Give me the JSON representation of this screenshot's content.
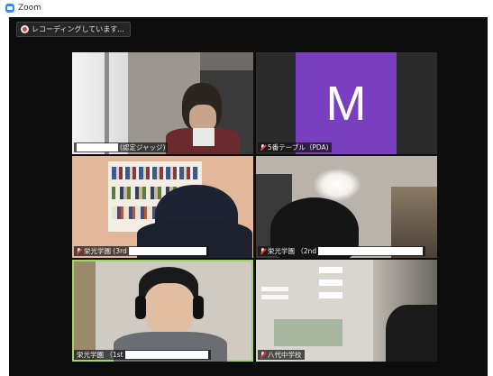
{
  "window": {
    "title": "Zoom",
    "icon": "zoom-logo-icon"
  },
  "recording": {
    "text": "レコーディングしています...",
    "icon": "cloud-record-icon"
  },
  "participants": [
    {
      "label": "(認定ジャッジ)",
      "muted": true,
      "kind": "video"
    },
    {
      "label": "5番テーブル（PDA)",
      "muted": true,
      "kind": "avatar",
      "avatar_letter": "M",
      "avatar_color": "#7a3ec1"
    },
    {
      "label": "栄光学園 (3rd",
      "muted": true,
      "kind": "video"
    },
    {
      "label": "栄光学園 （2nd",
      "muted": true,
      "kind": "video"
    },
    {
      "label": "栄光学園 （1st",
      "muted": false,
      "kind": "video",
      "active_speaker": true
    },
    {
      "label": "八代中学校",
      "muted": true,
      "kind": "video"
    }
  ],
  "colors": {
    "active_border": "#a5d36b",
    "stage_bg": "#0d0d0d",
    "muted_mic": "#e63b3b"
  }
}
